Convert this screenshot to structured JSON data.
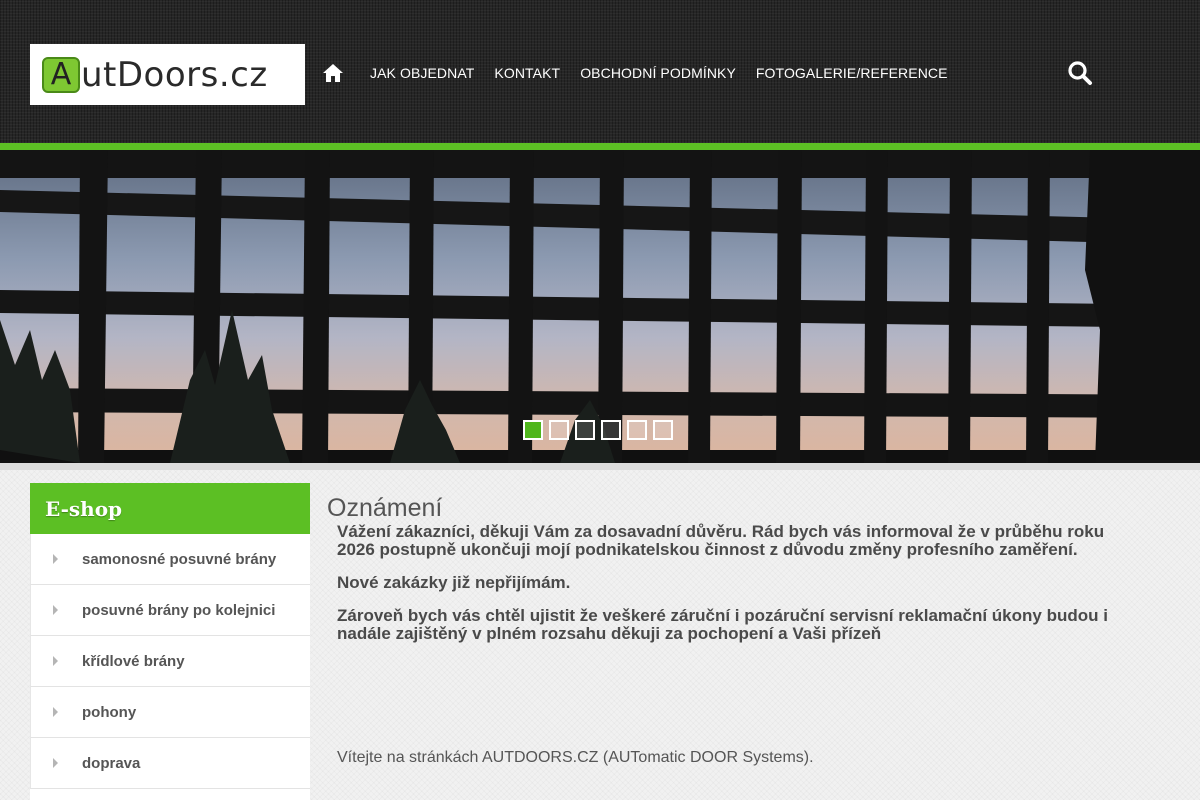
{
  "logo": {
    "letter": "A",
    "text": "utDoors.cz"
  },
  "nav": {
    "items": [
      "JAK OBJEDNAT",
      "KONTAKT",
      "OBCHODNÍ PODMÍNKY",
      "FOTOGALERIE/REFERENCE"
    ]
  },
  "slider": {
    "slide_count": 6,
    "active_slide": 1
  },
  "sidebar": {
    "title": "E-shop",
    "items": [
      "samonosné posuvné brány",
      "posuvné brány po kolejnici",
      "křídlové brány",
      "pohony",
      "doprava"
    ]
  },
  "main": {
    "title": "Oznámení",
    "paragraphs": [
      "Vážení zákazníci, děkuji Vám za dosavadní důvěru. Rád bych vás informoval že v průběhu roku 2026 postupně ukončuji mojí podnikatelskou činnost z důvodu změny profesního zaměření.",
      "Nové zakázky již nepřijímám.",
      "Zároveň bych vás chtěl ujistit že veškeré záruční i pozáruční servisní reklamační úkony budou i nadále zajištěný v plném rozsahu děkuji za pochopení a Vaši přízeň"
    ],
    "welcome": "Vítejte na stránkách AUTDOORS.CZ (AUTomatic DOOR Systems)."
  },
  "colors": {
    "brand_green": "#5cbf24",
    "header_dark": "#262626"
  },
  "icons": {
    "home": "home-icon",
    "search": "search-icon",
    "bullet": "chevron-right-icon"
  }
}
